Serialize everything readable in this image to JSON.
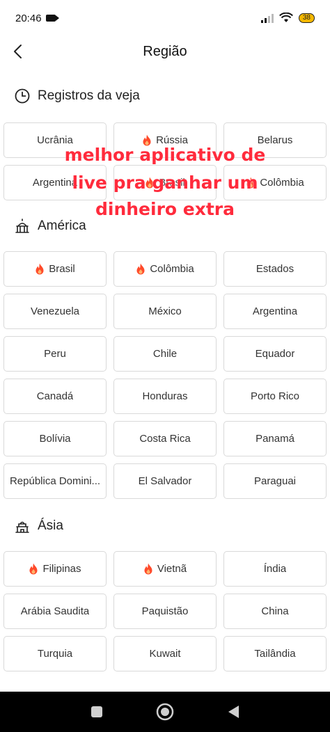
{
  "status": {
    "time": "20:46",
    "battery": "38"
  },
  "header": {
    "title": "Região"
  },
  "sections": {
    "recent": {
      "title": "Registros da veja",
      "items": [
        {
          "label": "Ucrânia",
          "hot": false
        },
        {
          "label": "Rússia",
          "hot": true
        },
        {
          "label": "Belarus",
          "hot": false
        },
        {
          "label": "Argentina",
          "hot": false
        },
        {
          "label": "Brasil",
          "hot": true
        },
        {
          "label": "Colômbia",
          "hot": true
        }
      ]
    },
    "america": {
      "title": "América",
      "items": [
        {
          "label": "Brasil",
          "hot": true
        },
        {
          "label": "Colômbia",
          "hot": true
        },
        {
          "label": "Estados",
          "hot": false
        },
        {
          "label": "Venezuela",
          "hot": false
        },
        {
          "label": "México",
          "hot": false
        },
        {
          "label": "Argentina",
          "hot": false
        },
        {
          "label": "Peru",
          "hot": false
        },
        {
          "label": "Chile",
          "hot": false
        },
        {
          "label": "Equador",
          "hot": false
        },
        {
          "label": "Canadá",
          "hot": false
        },
        {
          "label": "Honduras",
          "hot": false
        },
        {
          "label": "Porto Rico",
          "hot": false
        },
        {
          "label": "Bolívia",
          "hot": false
        },
        {
          "label": "Costa Rica",
          "hot": false
        },
        {
          "label": "Panamá",
          "hot": false
        },
        {
          "label": "República Domini...",
          "hot": false
        },
        {
          "label": "El Salvador",
          "hot": false
        },
        {
          "label": "Paraguai",
          "hot": false
        }
      ]
    },
    "asia": {
      "title": "Ásia",
      "items": [
        {
          "label": "Filipinas",
          "hot": true
        },
        {
          "label": "Vietnã",
          "hot": true
        },
        {
          "label": "Índia",
          "hot": false
        },
        {
          "label": "Arábia Saudita",
          "hot": false
        },
        {
          "label": "Paquistão",
          "hot": false
        },
        {
          "label": "China",
          "hot": false
        },
        {
          "label": "Turquia",
          "hot": false
        },
        {
          "label": "Kuwait",
          "hot": false
        },
        {
          "label": "Tailândia",
          "hot": false
        }
      ]
    }
  },
  "overlay": {
    "line1": "melhor aplicativo de",
    "line2": "live pra ganhar um",
    "line3": "dinheiro extra"
  },
  "colors": {
    "overlay": "#ff2b3c",
    "fire": "#ff4a2a",
    "chip_border": "#d9d9d9"
  }
}
